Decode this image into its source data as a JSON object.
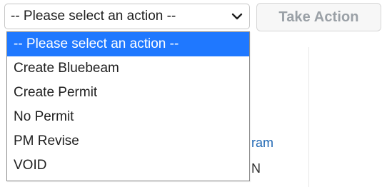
{
  "form": {
    "select": {
      "value": "-- Please select an action --",
      "icon": "chevron-down-icon"
    },
    "button": {
      "label": "Take Action",
      "state": "disabled"
    },
    "dropdown": {
      "options": [
        {
          "label": "-- Please select an action --",
          "selected": true
        },
        {
          "label": "Create Bluebeam",
          "selected": false
        },
        {
          "label": "Create Permit",
          "selected": false
        },
        {
          "label": "No Permit",
          "selected": false
        },
        {
          "label": "PM Revise",
          "selected": false
        },
        {
          "label": "VOID",
          "selected": false
        }
      ]
    }
  },
  "background": {
    "fragments": [
      "ram",
      "N"
    ],
    "link_color": "#1f67b3"
  },
  "colors": {
    "accent": "#1f78ff"
  }
}
